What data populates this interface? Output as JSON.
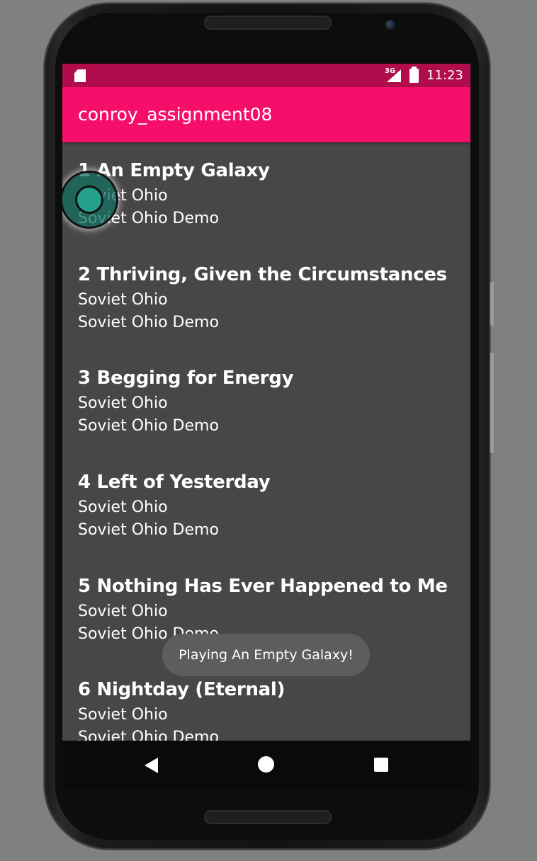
{
  "status_bar": {
    "network": "3G",
    "time": "11:23",
    "icons": [
      "sd-card-icon",
      "signal-icon",
      "battery-charging-icon"
    ]
  },
  "app_bar": {
    "title": "conroy_assignment08"
  },
  "songs": [
    {
      "title": "1  An Empty Galaxy",
      "artist": "Soviet Ohio",
      "album": "Soviet Ohio Demo"
    },
    {
      "title": "2  Thriving, Given the Circumstances",
      "artist": "Soviet Ohio",
      "album": "Soviet Ohio Demo"
    },
    {
      "title": "3  Begging for Energy",
      "artist": "Soviet Ohio",
      "album": "Soviet Ohio Demo"
    },
    {
      "title": "4  Left of Yesterday",
      "artist": "Soviet Ohio",
      "album": "Soviet Ohio Demo"
    },
    {
      "title": "5  Nothing Has Ever Happened to Me",
      "artist": "Soviet Ohio",
      "album": "Soviet Ohio Demo"
    },
    {
      "title": "6  Nightday (Eternal)",
      "artist": "Soviet Ohio",
      "album": "Soviet Ohio Demo"
    }
  ],
  "toast": {
    "message": "Playing An Empty Galaxy!"
  },
  "nav_bar": {
    "icons": [
      "back-icon",
      "home-icon",
      "recents-icon"
    ]
  },
  "colors": {
    "status_bar": "#b10d4c",
    "app_bar": "#f50f6b",
    "list_background": "#474747",
    "toast_background": "#5d5d5d",
    "touch_indicator": "#25a08c"
  }
}
